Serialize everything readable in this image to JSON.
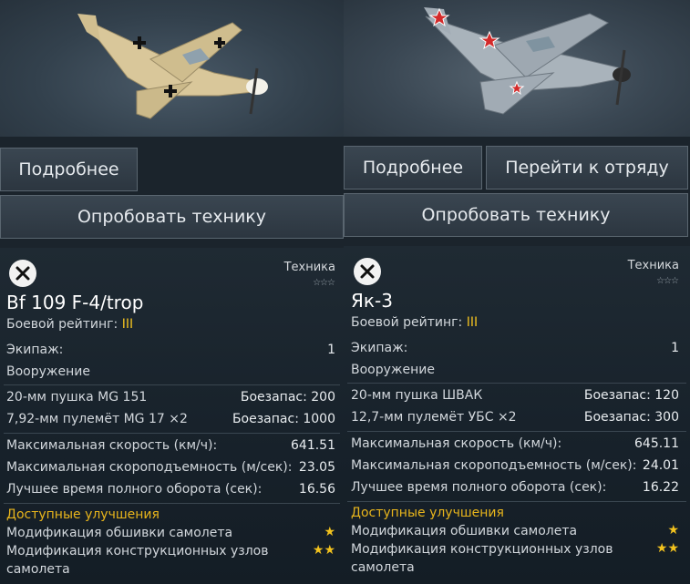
{
  "left": {
    "buttons": {
      "details": "Подробнее",
      "try": "Опробовать технику"
    },
    "category": "Техника",
    "name": "Bf 109 F-4/trop",
    "br_label": "Боевой рейтинг:",
    "br_value": "III",
    "crew_label": "Экипаж:",
    "crew_value": "1",
    "armament_label": "Вооружение",
    "weapons": [
      {
        "name": "20-мм пушка MG 151",
        "ammo_label": "Боезапас:",
        "ammo": "200"
      },
      {
        "name": "7,92-мм пулемёт MG 17 ×2",
        "ammo_label": "Боезапас:",
        "ammo": "1000"
      }
    ],
    "stats": [
      {
        "label": "Максимальная скорость (км/ч):",
        "value": "641.51"
      },
      {
        "label": "Максимальная скороподъемность (м/сек):",
        "value": "23.05"
      },
      {
        "label": "Лучшее время полного оборота (сек):",
        "value": "16.56"
      }
    ],
    "upgrades_title": "Доступные улучшения",
    "upgrades": [
      {
        "label": "Модификация обшивки самолета",
        "stars": "★"
      },
      {
        "label": "Модификация конструкционных узлов",
        "label2": "самолета",
        "stars": "★★"
      }
    ]
  },
  "right": {
    "buttons": {
      "details": "Подробнее",
      "squad": "Перейти к отряду",
      "try": "Опробовать технику"
    },
    "category": "Техника",
    "name": "Як-3",
    "br_label": "Боевой рейтинг:",
    "br_value": "III",
    "crew_label": "Экипаж:",
    "crew_value": "1",
    "armament_label": "Вооружение",
    "weapons": [
      {
        "name": "20-мм пушка ШВАК",
        "ammo_label": "Боезапас:",
        "ammo": "120"
      },
      {
        "name": "12,7-мм пулемёт УБС ×2",
        "ammo_label": "Боезапас:",
        "ammo": "300"
      }
    ],
    "stats": [
      {
        "label": "Максимальная скорость (км/ч):",
        "value": "645.11"
      },
      {
        "label": "Максимальная скороподъемность (м/сек):",
        "value": "24.01"
      },
      {
        "label": "Лучшее время полного оборота (сек):",
        "value": "16.22"
      }
    ],
    "upgrades_title": "Доступные улучшения",
    "upgrades": [
      {
        "label": "Модификация обшивки самолета",
        "stars": "★"
      },
      {
        "label": "Модификация конструкционных узлов",
        "label2": "самолета",
        "stars": "★★"
      }
    ]
  },
  "rank_stars": "☆☆☆",
  "colors": {
    "accent_gold": "#f0c020",
    "upgrade_title": "#e8b51c"
  }
}
